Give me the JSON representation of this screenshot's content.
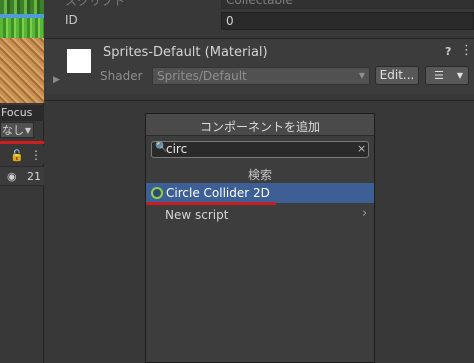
{
  "left": {
    "focus_label": "Focus",
    "focus_dropdown": "なし",
    "visible_count": "21"
  },
  "inspector": {
    "tag_row": {
      "label": "スクリプト",
      "value": "Collectable"
    },
    "id_row": {
      "label": "ID",
      "value": "0"
    },
    "material": {
      "title": "Sprites-Default (Material)",
      "shader_label": "Shader",
      "shader_value": "Sprites/Default",
      "edit_label": "Edit...",
      "list_label": "☰"
    }
  },
  "popup": {
    "title": "コンポーネントを追加",
    "search": {
      "value": "circ",
      "placeholder": ""
    },
    "section": "検索",
    "results": [
      {
        "label": "Circle Collider 2D",
        "icon": "circle-collider-icon",
        "selected": true
      },
      {
        "label": "New script",
        "icon": "chevron-right-icon",
        "selected": false
      }
    ]
  },
  "colors": {
    "selection": "#3e5f96",
    "annotation_red": "#c71f1f",
    "collider_green": "#8fd24a"
  }
}
